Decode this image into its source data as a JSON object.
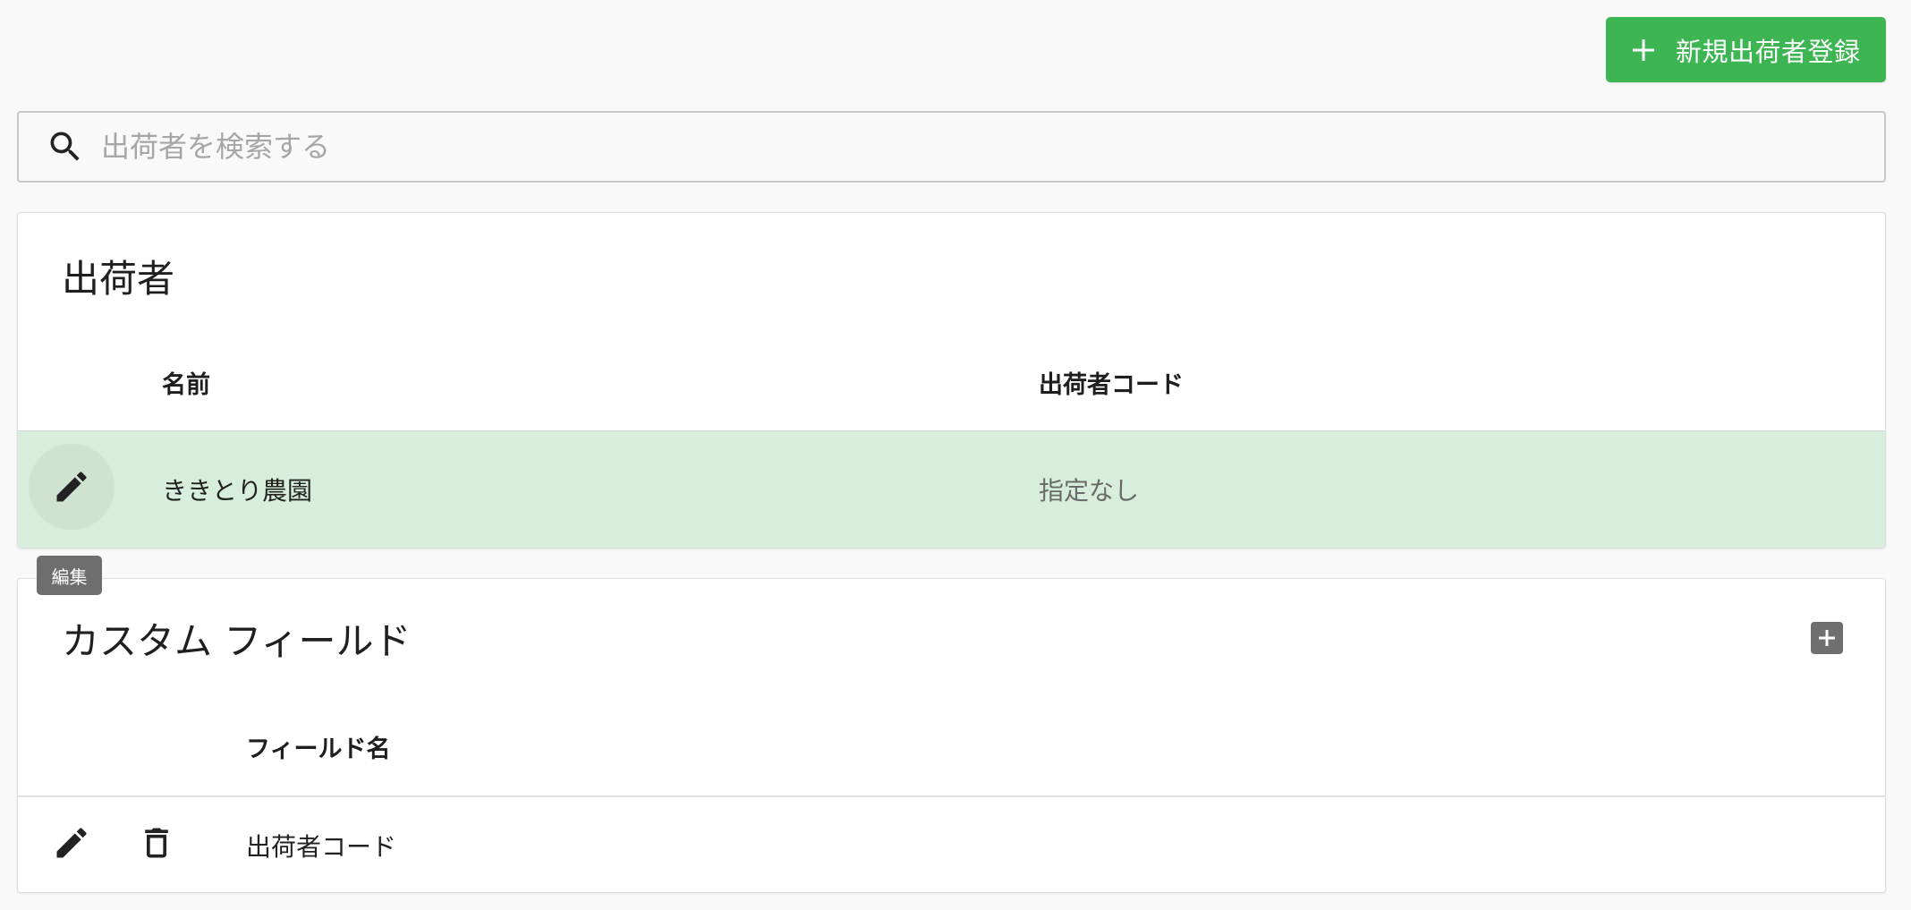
{
  "header": {
    "new_button_label": "新規出荷者登録"
  },
  "search": {
    "placeholder": "出荷者を検索する",
    "value": ""
  },
  "shippers": {
    "title": "出荷者",
    "columns": [
      "名前",
      "出荷者コード"
    ],
    "rows": [
      {
        "name": "ききとり農園",
        "code": "指定なし"
      }
    ],
    "edit_tooltip": "編集"
  },
  "custom_fields": {
    "title": "カスタム フィールド",
    "columns": [
      "フィールド名"
    ],
    "rows": [
      {
        "field_name": "出荷者コード"
      }
    ]
  },
  "colors": {
    "accent_green": "#3cb552",
    "selected_row": "#d8eedc",
    "tooltip_bg": "#6e6e6e"
  },
  "icons": [
    "plus-icon",
    "search-icon",
    "pencil-icon",
    "trash-icon",
    "add-box-icon"
  ]
}
